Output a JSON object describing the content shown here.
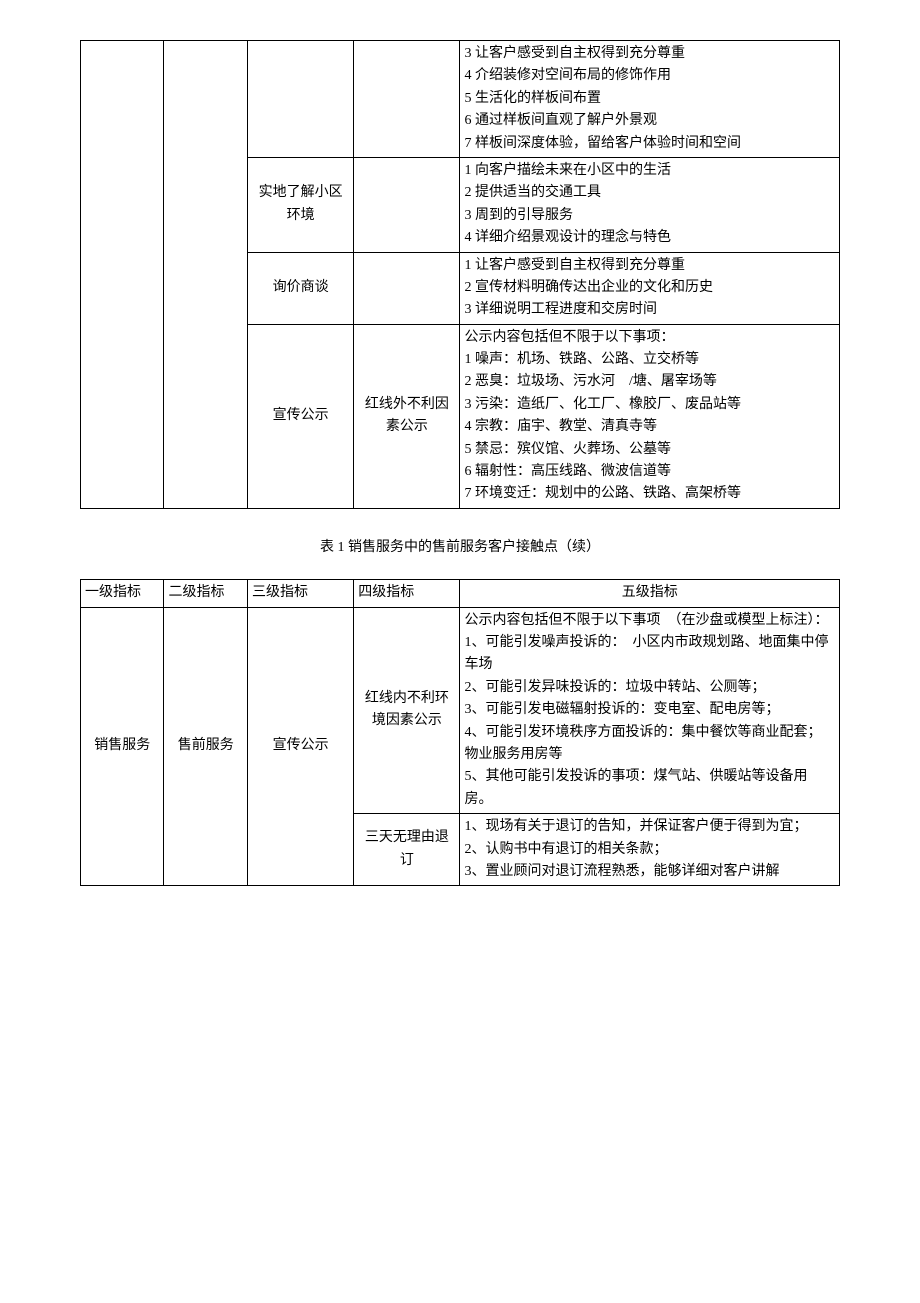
{
  "table1": {
    "rows": [
      {
        "c1": "",
        "c2": "",
        "c3": "",
        "c4": "",
        "c5": "3 让客户感受到自主权得到充分尊重\n4 介绍装修对空间布局的修饰作用\n5 生活化的样板间布置\n6 通过样板间直观了解户外景观\n7 样板间深度体验，留给客户体验时间和空间"
      },
      {
        "c3": "实地了解小区环境",
        "c4": "",
        "c5": "1 向客户描绘未来在小区中的生活\n2 提供适当的交通工具\n3 周到的引导服务\n4 详细介绍景观设计的理念与特色"
      },
      {
        "c3": "询价商谈",
        "c4": "",
        "c5": "1 让客户感受到自主权得到充分尊重\n2 宣传材料明确传达出企业的文化和历史\n3 详细说明工程进度和交房时间"
      },
      {
        "c3": "宣传公示",
        "c4": "红线外不利因素公示",
        "c5": "公示内容包括但不限于以下事项：\n1 噪声：机场、铁路、公路、立交桥等\n2 恶臭：垃圾场、污水河　/塘、屠宰场等\n3 污染：造纸厂、化工厂、橡胶厂、废品站等\n4 宗教：庙宇、教堂、清真寺等\n5 禁忌：殡仪馆、火葬场、公墓等\n6 辐射性：高压线路、微波信道等\n7 环境变迁：规划中的公路、铁路、高架桥等"
      }
    ]
  },
  "caption": "表 1 销售服务中的售前服务客户接触点（续）",
  "table2": {
    "headers": [
      "一级指标",
      "二级指标",
      "三级指标",
      "四级指标",
      "五级指标"
    ],
    "c1": "销售服务",
    "c2": "售前服务",
    "c3": "宣传公示",
    "rows": [
      {
        "c4": "红线内不利环境因素公示",
        "c5": "公示内容包括但不限于以下事项　（在沙盘或模型上标注）：\n1、可能引发噪声投诉的：　小区内市政规划路、地面集中停车场\n2、可能引发异味投诉的：垃圾中转站、公厕等；\n3、可能引发电磁辐射投诉的：变电室、配电房等；\n4、可能引发环境秩序方面投诉的：集中餐饮等商业配套；　物业服务用房等\n5、其他可能引发投诉的事项：煤气站、供暖站等设备用房。"
      },
      {
        "c4": "三天无理由退订",
        "c5": "1、现场有关于退订的告知，并保证客户便于得到为宜；\n2、认购书中有退订的相关条款；\n3、置业顾问对退订流程熟悉，能够详细对客户讲解"
      }
    ]
  }
}
